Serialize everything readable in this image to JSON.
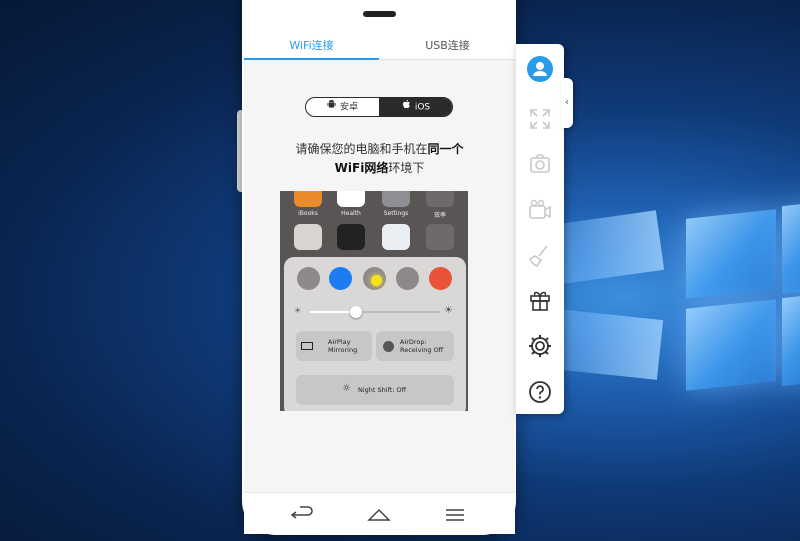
{
  "tabs": {
    "wifi": "WiFi连接",
    "usb": "USB连接"
  },
  "platform": {
    "android": "安卓",
    "ios": "iOS",
    "selected": "iOS"
  },
  "instruction": {
    "line1": "请确保您的电脑和手机在",
    "line1_bold": "同一个",
    "line2_bold": "WiFi网络",
    "line2": "环境下"
  },
  "ios_screenshot": {
    "apps": [
      "iBooks",
      "Health",
      "Settings",
      "效率"
    ],
    "airplay_line1": "AirPlay",
    "airplay_line2": "Mirroring",
    "airdrop_line1": "AirDrop:",
    "airdrop_line2": "Receiving Off",
    "night_shift": "Night Shift: Off"
  },
  "toolbar": [
    "user-icon",
    "fullscreen-icon",
    "screenshot-icon",
    "record-icon",
    "cleanup-icon",
    "gift-icon",
    "settings-icon",
    "help-icon"
  ],
  "colors": {
    "accent": "#2a9be8",
    "segment_dark": "#2a2a2a"
  }
}
